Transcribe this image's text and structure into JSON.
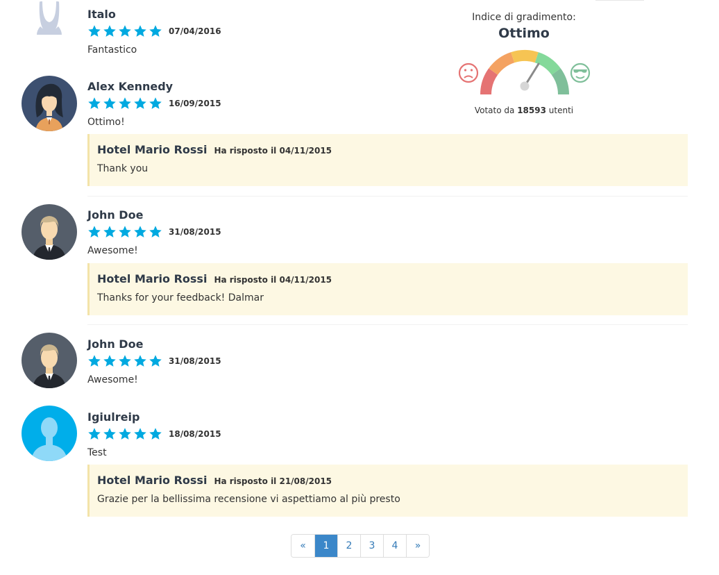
{
  "rating": {
    "label": "Indice di gradimento:",
    "value": "Ottimo",
    "votes_prefix": "Votato da",
    "votes_count": "18593",
    "votes_suffix": "utenti",
    "colors": [
      "#e57373",
      "#f4a261",
      "#f6c453",
      "#84d99a",
      "#7fbf9a"
    ]
  },
  "reviews": [
    {
      "author": "Italo",
      "stars": 5,
      "date": "07/04/2016",
      "text": "Fantastico",
      "avatar": "default-avatar-icon"
    },
    {
      "author": "Alex Kennedy",
      "stars": 5,
      "date": "16/09/2015",
      "text": "Ottimo!",
      "avatar": "woman-avatar-icon",
      "reply": {
        "author": "Hotel Mario Rossi",
        "meta": "Ha risposto il 04/11/2015",
        "text": "Thank you"
      }
    },
    {
      "author": "John Doe",
      "stars": 5,
      "date": "31/08/2015",
      "text": "Awesome!",
      "avatar": "man-avatar-icon",
      "reply": {
        "author": "Hotel Mario Rossi",
        "meta": "Ha risposto il 04/11/2015",
        "text": "Thanks for your feedback! Dalmar"
      }
    },
    {
      "author": "John Doe",
      "stars": 5,
      "date": "31/08/2015",
      "text": "Awesome!",
      "avatar": "man-avatar-icon"
    },
    {
      "author": "Igiulreip",
      "stars": 5,
      "date": "18/08/2015",
      "text": "Test",
      "avatar": "silhouette-avatar-icon",
      "reply": {
        "author": "Hotel Mario Rossi",
        "meta": "Ha risposto il 21/08/2015",
        "text": "Grazie per la bellissima recensione vi aspettiamo al più presto"
      }
    }
  ],
  "pagination": {
    "prev": "«",
    "pages": [
      "1",
      "2",
      "3",
      "4"
    ],
    "active": "1",
    "next": "»"
  },
  "colors": {
    "star": "#00a9e0",
    "reply_bg": "#fdf8e3",
    "active_page": "#3b87c9"
  }
}
